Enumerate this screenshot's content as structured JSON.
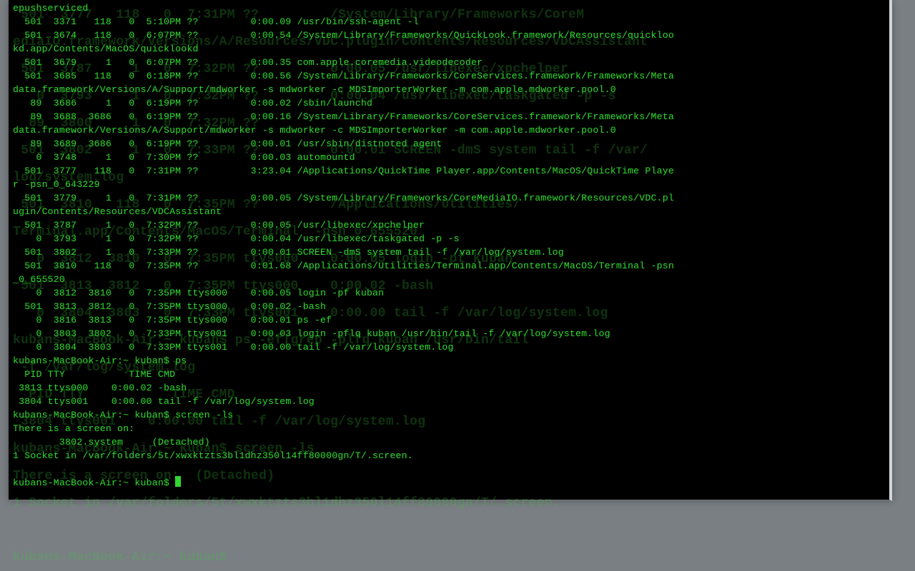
{
  "colors": {
    "bg": "#000000",
    "fg": "#31d631",
    "ghost": "rgba(60,200,60,0.25)"
  },
  "ghost": [
    " 501  3777   118   0  7:31PM ??         /System/Library/Frameworks/CoreM",
    "ediaIO.framework/Versions/A/Resources/VDC.plugin/Contents/Resources/VDCAssistant",
    " 501  3787     1   0  7:32PM ??         0:00.05 /usr/libexec/xpchelper",
    "   0  3793     1   0  7:32PM ??         0:00.04 /usr/libexec/taskgated -p -s",
    "  89  3800     1   0  7:32PM ??         ",
    " 501  3802     1   0  7:33PM ??         0:00.01 SCREEN -dmS system tail -f /var/",
    "log/system.log                                                               ",
    " 501  3810   118   0  7:35PM ??         /Applications/Utilities/",
    "Terminal.app/Contents/MacOS/Terminal  -psn_0_655520",
    "   0  3812  3810   0  7:35PM ttys000    0:00.05 login -pf kuban",
    " 501  3813  3812   0  7:35PM ttys000    0:00.02 -bash",
    "   0  3804  3803   0  7:33PM ttys001    0:00.00 tail -f /var/log/system.log",
    "kubans-MacBook-Air:~ kuban$ ps -ef|grep -plfq kuban /usr/bin/tail",
    " -f /var/log/system.log",
    "  PID TTY           TIME CMD",
    " 3804 ttys001    0:00.00 tail -f /var/log/system.log",
    "kubans-MacBook-Air:~ kuban$ screen -ls",
    "There is a screen on:  (Detached)",
    "1 Socket in /var/folders/5t/xwxktzts3bl1dhz350l14ff80000gn/T/.screen.",
    "",
    "kubans-MacBook-Air:~ kuban$"
  ],
  "lines": [
    "epushserviced",
    "  501  3371   118   0  5:10PM ??         0:00.09 /usr/bin/ssh-agent -l",
    "  501  3674   118   0  6:07PM ??         0:00.54 /System/Library/Frameworks/QuickLook.framework/Resources/quickloo",
    "kd.app/Contents/MacOS/quicklookd",
    "  501  3679     1   0  6:07PM ??         0:00.35 com.apple.coremedia.videodecoder",
    "  501  3685   118   0  6:18PM ??         0:00.56 /System/Library/Frameworks/CoreServices.framework/Frameworks/Meta",
    "data.framework/Versions/A/Support/mdworker -s mdworker -c MDSImporterWorker -m com.apple.mdworker.pool.0",
    "   89  3686     1   0  6:19PM ??         0:00.02 /sbin/launchd",
    "   89  3688  3686   0  6:19PM ??         0:00.16 /System/Library/Frameworks/CoreServices.framework/Frameworks/Meta",
    "data.framework/Versions/A/Support/mdworker -s mdworker -c MDSImporterWorker -m com.apple.mdworker.pool.0",
    "   89  3689  3686   0  6:19PM ??         0:00.01 /usr/sbin/distnoted agent",
    "    0  3748     1   0  7:30PM ??         0:00.03 automountd",
    "  501  3777   118   0  7:31PM ??         3:23.04 /Applications/QuickTime Player.app/Contents/MacOS/QuickTime Playe",
    "r -psn_0_643229",
    "  501  3779     1   0  7:31PM ??         0:00.05 /System/Library/Frameworks/CoreMediaIO.framework/Resources/VDC.pl",
    "ugin/Contents/Resources/VDCAssistant",
    "  501  3787     1   0  7:32PM ??         0:00.05 /usr/libexec/xpchelper",
    "    0  3793     1   0  7:32PM ??         0:00.04 /usr/libexec/taskgated -p -s",
    "  501  3802     1   0  7:33PM ??         0:00.01 SCREEN -dmS system tail -f /var/log/system.log",
    "  501  3810   118   0  7:35PM ??         0:01.68 /Applications/Utilities/Terminal.app/Contents/MacOS/Terminal -psn",
    "_0_655520",
    "    0  3812  3810   0  7:35PM ttys000    0:00.05 login -pf kuban",
    "  501  3813  3812   0  7:35PM ttys000    0:00.02 -bash",
    "    0  3816  3813   0  7:35PM ttys000    0:00.01 ps -ef",
    "    0  3803  3802   0  7:33PM ttys001    0:00.03 login -pflq kuban /usr/bin/tail -f /var/log/system.log",
    "    0  3804  3803   0  7:33PM ttys001    0:00.00 tail -f /var/log/system.log",
    "kubans-MacBook-Air:~ kuban$ ps",
    "  PID TTY           TIME CMD",
    " 3813 ttys000    0:00.02 -bash",
    " 3804 ttys001    0:00.00 tail -f /var/log/system.log",
    "kubans-MacBook-Air:~ kuban$ screen -ls",
    "There is a screen on:",
    "        3802.system     (Detached)",
    "1 Socket in /var/folders/5t/xwxktzts3bl1dhz350l14ff80000gn/T/.screen.",
    "",
    "kubans-MacBook-Air:~ kuban$ "
  ],
  "prompt": "kubans-MacBook-Air:~ kuban$"
}
